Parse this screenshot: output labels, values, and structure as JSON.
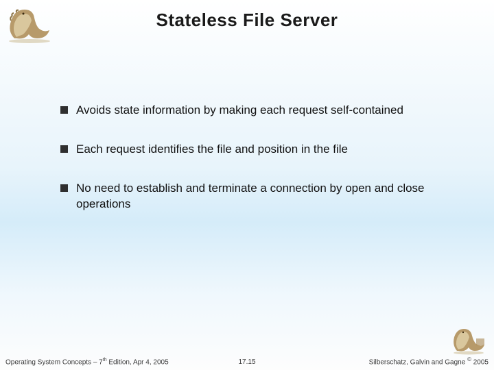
{
  "title": "Stateless File Server",
  "bullets": [
    "Avoids state information by making each request self-contained",
    "Each request identifies the file and position in the file",
    "No need to establish and terminate a connection by open and close operations"
  ],
  "footer": {
    "left_pre": "Operating System Concepts – 7",
    "left_sup": "th",
    "left_post": " Edition, Apr 4, 2005",
    "center": "17.15",
    "right_pre": "Silberschatz, Galvin and Gagne ",
    "right_copy": "©",
    "right_post": " 2005"
  },
  "logo_colors": {
    "body": "#b79a6a",
    "belly": "#d9c79d",
    "shadow": "#8a7042"
  }
}
